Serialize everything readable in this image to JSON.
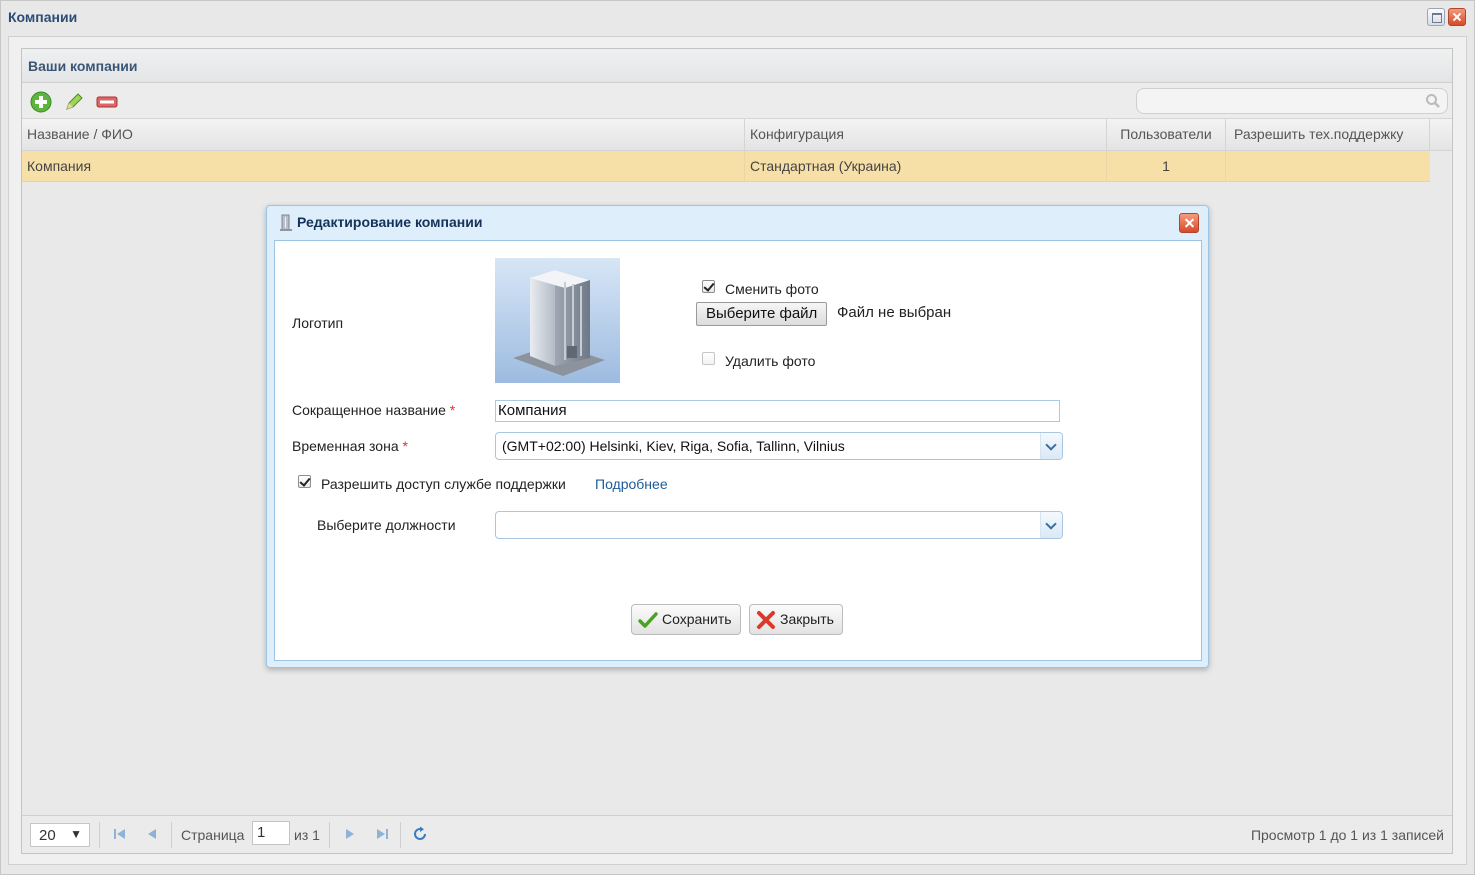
{
  "window": {
    "title": "Компании"
  },
  "panel": {
    "title": "Ваши компании",
    "toolbar": {
      "add_icon": "plus-icon",
      "edit_icon": "pencil-icon",
      "delete_icon": "minus-icon",
      "search_placeholder": ""
    }
  },
  "grid": {
    "columns": [
      "Название / ФИО",
      "Конфигурация",
      "Пользователи",
      "Разрешить тех.поддержку"
    ],
    "rows": [
      {
        "name": "Компания",
        "config": "Стандартная (Украина)",
        "users": "1",
        "support": ""
      }
    ]
  },
  "pager": {
    "page_size": "20",
    "page_label": "Страница",
    "page_value": "1",
    "of_label": "из 1",
    "info": "Просмотр 1 до 1 из 1 записей"
  },
  "dialog": {
    "title": "Редактирование компании",
    "logo_label": "Логотип",
    "change_photo_label": "Сменить фото",
    "change_photo_checked": true,
    "file_button_label": "Выберите файл",
    "file_status": "Файл не выбран",
    "delete_photo_label": "Удалить фото",
    "delete_photo_checked": false,
    "short_name_label": "Сокращенное название",
    "short_name_value": "Компания",
    "timezone_label": "Временная зона",
    "timezone_value": "(GMT+02:00) Helsinki, Kiev, Riga, Sofia, Tallinn, Vilnius",
    "required_mark": "*",
    "support_access_label": "Разрешить доступ службе поддержки",
    "support_access_checked": true,
    "more_link": "Подробнее",
    "positions_label": "Выберите должности",
    "positions_value": "",
    "save_label": "Сохранить",
    "close_label": "Закрыть"
  },
  "colors": {
    "selected_row": "#f7e0a8",
    "title_blue": "#2b4d75",
    "link_blue": "#1d5c9a",
    "required_red": "#d33333"
  }
}
